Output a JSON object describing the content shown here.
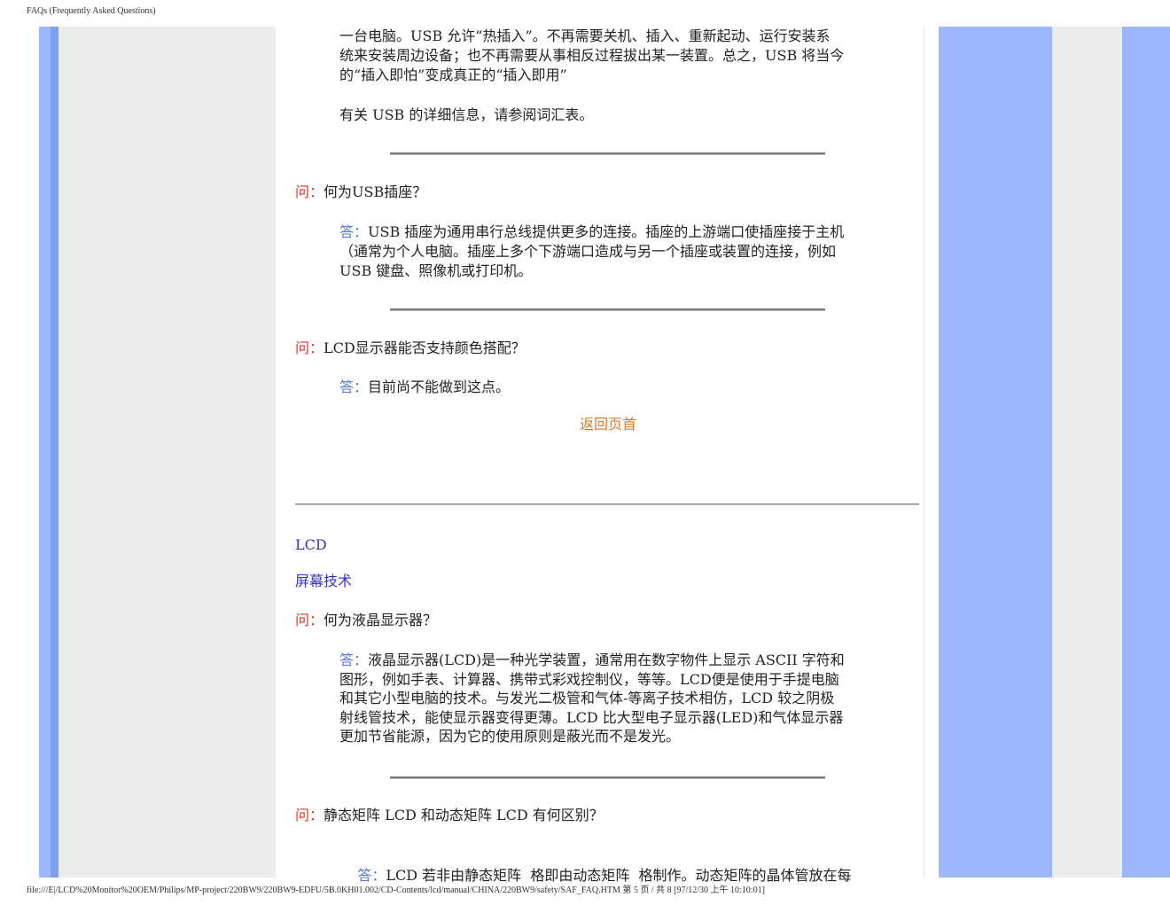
{
  "header": "FAQs (Frequently Asked Questions)",
  "footer": "file:///E|/LCD%20Monitor%20OEM/Philips/MP-project/220BW9/220BW9-EDFU/5B.0KH01.002/CD-Contents/lcd/manual/CHINA/220BW9/safety/SAF_FAQ.HTM 第 5 页 / 共 8  [97/12/30 上午 10:10:01]",
  "usb_cont": {
    "lines": [
      "一台电脑。USB 允许“热插入”。不再需要关机、插入、重新起动、运行安装系",
      "统来安装周边设备；也不再需要从事相反过程拔出某一装置。总之，USB 将当今",
      "的“插入即怕”变成真正的“插入即用”"
    ],
    "more": "有关 USB 的详细信息，请参阅词汇表。"
  },
  "q1": {
    "q_label": "问：",
    "question": "何为USB插座？",
    "a_label": "答：",
    "lines": [
      "USB 插座为通用串行总线提供更多的连接。插座的上游端口使插座接于主机",
      "（通常为个人电脑。插座上多个下游端口造成与另一个插座或装置的连接，例如",
      "USB 键盘、照像机或打印机。"
    ]
  },
  "q2": {
    "q_label": "问：",
    "question": "LCD显示器能否支持颜色搭配？",
    "a_label": "答：",
    "answer": "目前尚不能做到这点。"
  },
  "back_to_top": "返回页首",
  "section": {
    "title1": "LCD",
    "title2": "屏幕技术"
  },
  "q3": {
    "q_label": "问：",
    "question": "何为液晶显示器？",
    "a_label": "答：",
    "lines": [
      "液晶显示器(LCD)是一种光学装置，通常用在数字物件上显示 ASCII 字符和",
      "图形，例如手表、计算器、携带式彩戏控制仪，等等。LCD便是使用于手提电脑",
      "和其它小型电脑的技术。与发光二极管和气体-等离子技术相仿，LCD 较之阴极",
      "射线管技术，能使显示器变得更薄。LCD 比大型电子显示器(LED)和气体显示器",
      "更加节省能源，因为它的使用原则是蔽光而不是发光。"
    ]
  },
  "q4": {
    "q_label": "问：",
    "question": "静态矩阵 LCD 和动态矩阵 LCD 有何区别？",
    "a_label": "答：",
    "answer": "LCD 若非由静态矩阵  格即由动态矩阵  格制作。动态矩阵的晶体管放在每"
  }
}
